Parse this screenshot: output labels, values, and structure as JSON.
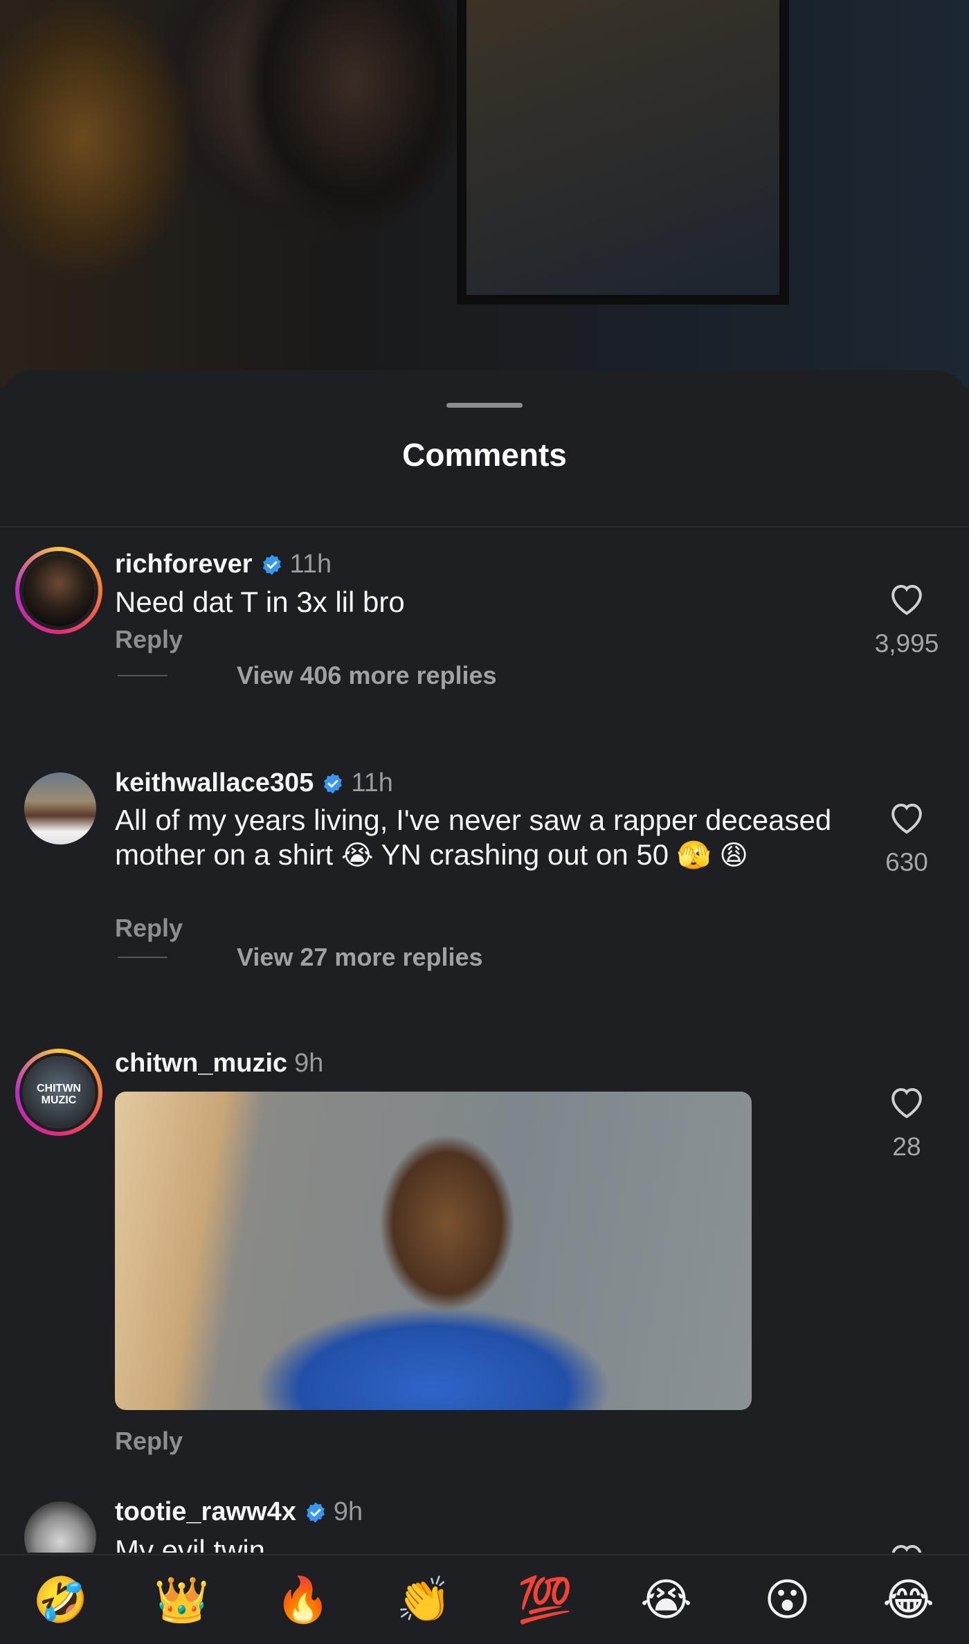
{
  "sheet": {
    "title": "Comments"
  },
  "comments": [
    {
      "username": "richforever",
      "verified": true,
      "time": "11h",
      "text": "Need dat T in 3x lil bro",
      "reply_label": "Reply",
      "likes": "3,995",
      "view_more": "View 406 more replies"
    },
    {
      "username": "keithwallace305",
      "verified": true,
      "time": "11h",
      "text_parts": [
        "All of my years living, I've never saw a rapper deceased mother on a shirt ",
        "😭",
        " YN crashing out on 50 ",
        "🫣",
        " ",
        "😩"
      ],
      "reply_label": "Reply",
      "likes": "630",
      "view_more": "View 27 more replies"
    },
    {
      "username": "chitwn_muzic",
      "verified": false,
      "time": "9h",
      "avatar_text": "CHITWN MUZIC",
      "reply_label": "Reply",
      "likes": "28"
    },
    {
      "username": "tootie_raww4x",
      "verified": true,
      "time": "9h",
      "text": "My evil twin"
    }
  ],
  "emoji_bar": [
    "🤣",
    "👑",
    "🔥",
    "👏",
    "💯",
    "😭",
    "😮",
    "😂"
  ],
  "colors": {
    "background": "#1e1f23",
    "verified_blue": "#3897f0",
    "muted_text": "#8e8f95"
  }
}
